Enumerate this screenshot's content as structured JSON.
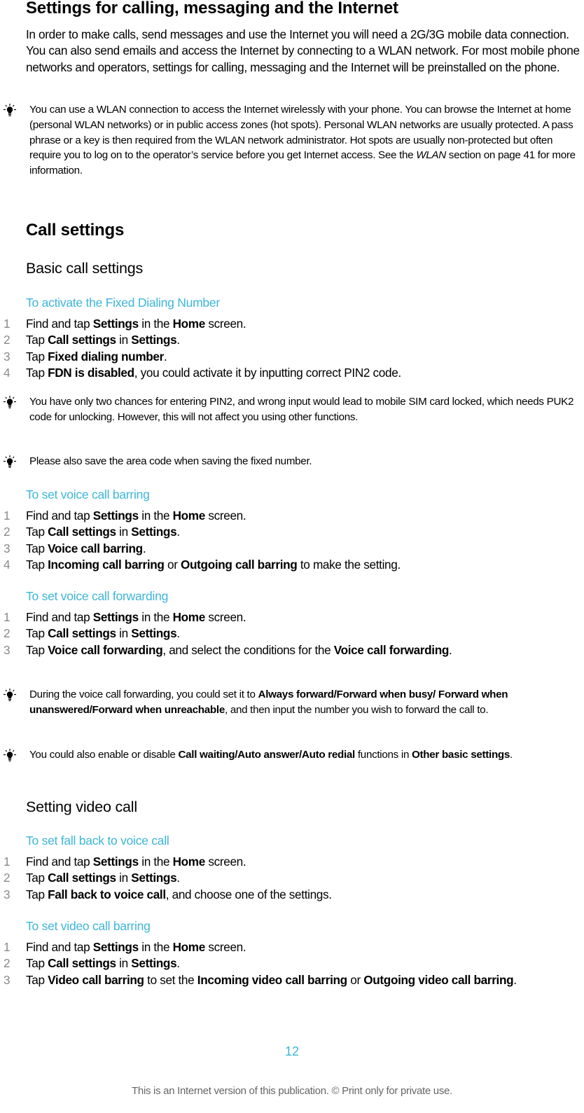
{
  "title": "Settings for calling, messaging and the Internet",
  "intro": "In order to make calls, send messages and use the Internet you will need a 2G/3G mobile data connection. You can also send emails and access the Internet by connecting to a WLAN network. For most mobile phone networks and operators, settings for calling, messaging and the Internet will be preinstalled on the phone.",
  "note_wlan": {
    "icon": "lightbulb-icon",
    "before": "You can use a WLAN connection to access the Internet wirelessly with your phone. You can browse the Internet at home (personal WLAN networks) or in public access zones (hot spots). Personal WLAN networks are usually protected. A pass phrase or a key is then required from the WLAN network administrator. Hot spots are usually non-protected but often require you to log on to the operator’s service before you get Internet access. See the ",
    "link": "WLAN",
    "after": " section on page 41 for more information."
  },
  "call_settings": {
    "heading": "Call settings",
    "basic": {
      "heading": "Basic call settings",
      "fdn": {
        "heading": "To activate the Fixed Dialing Number",
        "steps": [
          {
            "num": "1",
            "parts": [
              {
                "t": "Find and tap "
              },
              {
                "b": "Settings"
              },
              {
                "t": " in the "
              },
              {
                "b": "Home"
              },
              {
                "t": " screen."
              }
            ]
          },
          {
            "num": "2",
            "parts": [
              {
                "t": "Tap "
              },
              {
                "b": "Call settings"
              },
              {
                "t": " in "
              },
              {
                "b": "Settings"
              },
              {
                "t": "."
              }
            ]
          },
          {
            "num": "3",
            "parts": [
              {
                "t": "Tap "
              },
              {
                "b": "Fixed dialing number"
              },
              {
                "t": "."
              }
            ]
          },
          {
            "num": "4",
            "parts": [
              {
                "t": "Tap "
              },
              {
                "b": "FDN is disabled"
              },
              {
                "t": ", you could activate it by inputting correct PIN2 code."
              }
            ]
          }
        ],
        "notes": [
          "You have only two chances for entering PIN2, and wrong input would lead to mobile SIM card locked, which needs PUK2 code for unlocking. However, this will not affect you using other functions.",
          "Please also save the area code when saving the fixed number."
        ]
      },
      "barring": {
        "heading": "To set voice call barring",
        "steps": [
          {
            "num": "1",
            "parts": [
              {
                "t": "Find and tap "
              },
              {
                "b": "Settings"
              },
              {
                "t": " in the "
              },
              {
                "b": "Home"
              },
              {
                "t": " screen."
              }
            ]
          },
          {
            "num": "2",
            "parts": [
              {
                "t": "Tap "
              },
              {
                "b": "Call settings"
              },
              {
                "t": " in "
              },
              {
                "b": "Settings"
              },
              {
                "t": "."
              }
            ]
          },
          {
            "num": "3",
            "parts": [
              {
                "t": "Tap "
              },
              {
                "b": "Voice call barring"
              },
              {
                "t": "."
              }
            ]
          },
          {
            "num": "4",
            "parts": [
              {
                "t": "Tap "
              },
              {
                "b": "Incoming call barring"
              },
              {
                "t": " or "
              },
              {
                "b": "Outgoing call barring"
              },
              {
                "t": " to make the setting."
              }
            ]
          }
        ]
      },
      "forwarding": {
        "heading": "To set voice call forwarding",
        "steps": [
          {
            "num": "1",
            "parts": [
              {
                "t": "Find and tap "
              },
              {
                "b": "Settings"
              },
              {
                "t": " in the "
              },
              {
                "b": "Home"
              },
              {
                "t": " screen."
              }
            ]
          },
          {
            "num": "2",
            "parts": [
              {
                "t": "Tap "
              },
              {
                "b": "Call settings"
              },
              {
                "t": " in "
              },
              {
                "b": "Settings"
              },
              {
                "t": "."
              }
            ]
          },
          {
            "num": "3",
            "parts": [
              {
                "t": "Tap "
              },
              {
                "b": "Voice call forwarding"
              },
              {
                "t": ", and select the conditions for the "
              },
              {
                "b": "Voice call forwarding"
              },
              {
                "t": "."
              }
            ]
          }
        ],
        "notes": [
          [
            {
              "t": "During the voice call forwarding, you could set it to "
            },
            {
              "b": "Always forward/Forward when busy/ Forward when unanswered/Forward when unreachable"
            },
            {
              "t": ", and then input the number you wish to forward the call to."
            }
          ],
          [
            {
              "t": "You could also enable or disable "
            },
            {
              "b": "Call waiting/Auto answer/Auto redial"
            },
            {
              "t": " functions in "
            },
            {
              "b": "Other basic settings"
            },
            {
              "t": "."
            }
          ]
        ]
      }
    },
    "video": {
      "heading": "Setting video call",
      "fallback": {
        "heading": "To set fall back to voice call",
        "steps": [
          {
            "num": "1",
            "parts": [
              {
                "t": "Find and tap "
              },
              {
                "b": "Settings"
              },
              {
                "t": " in the "
              },
              {
                "b": "Home"
              },
              {
                "t": " screen."
              }
            ]
          },
          {
            "num": "2",
            "parts": [
              {
                "t": "Tap "
              },
              {
                "b": "Call settings"
              },
              {
                "t": " in "
              },
              {
                "b": "Settings"
              },
              {
                "t": "."
              }
            ]
          },
          {
            "num": "3",
            "parts": [
              {
                "t": "Tap "
              },
              {
                "b": "Fall back to voice call"
              },
              {
                "t": ", and choose one of the settings."
              }
            ]
          }
        ]
      },
      "barring": {
        "heading": "To set video call barring",
        "steps": [
          {
            "num": "1",
            "parts": [
              {
                "t": "Find and tap "
              },
              {
                "b": "Settings"
              },
              {
                "t": " in the "
              },
              {
                "b": "Home"
              },
              {
                "t": " screen."
              }
            ]
          },
          {
            "num": "2",
            "parts": [
              {
                "t": "Tap "
              },
              {
                "b": "Call settings"
              },
              {
                "t": " in "
              },
              {
                "b": "Settings"
              },
              {
                "t": "."
              }
            ]
          },
          {
            "num": "3",
            "parts": [
              {
                "t": "Tap "
              },
              {
                "b": "Video call barring"
              },
              {
                "t": " to set the "
              },
              {
                "b": "Incoming video call barring"
              },
              {
                "t": " or "
              },
              {
                "b": "Outgoing video call barring"
              },
              {
                "t": "."
              }
            ]
          }
        ]
      }
    }
  },
  "page_number": "12",
  "footer": "This is an Internet version of this publication. © Print only for private use.",
  "colors": {
    "accent": "#3db6d8",
    "step_number": "#8a8a8a",
    "text": "#000000",
    "footer": "#666666"
  }
}
